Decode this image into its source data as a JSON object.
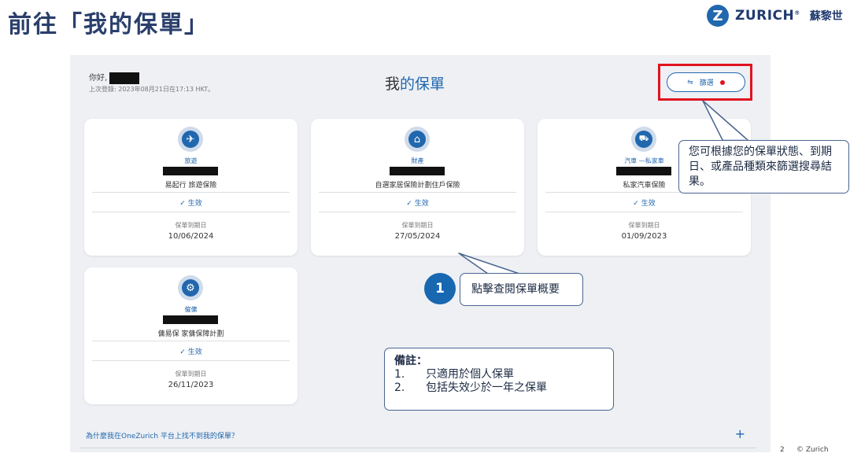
{
  "slide": {
    "title": "前往「我的保單」",
    "logo_mark": "Z",
    "logo_text": "ZURICH",
    "logo_reg": "®",
    "logo_cn": "蘇黎世",
    "page_number": "2",
    "footer_brand": "© Zurich"
  },
  "screen": {
    "greeting": "你好,",
    "last_login": "上次登錄: 2023年08月21日在17:13 HKT。",
    "title_part1": "我",
    "title_part2": "的保單",
    "filter_label": "篩選",
    "filter_icon": "filter-icon",
    "faq_link": "為什麼我在OneZurich 平台上找不到我的保單？",
    "faq_icon": "+"
  },
  "cards": [
    {
      "icon": "airplane-icon",
      "glyph": "✈",
      "category": "旅遊",
      "product": "易起行 旅遊保險",
      "status": "✓ 生效",
      "expiry_label": "保單到期日",
      "expiry_date": "10/06/2024"
    },
    {
      "icon": "house-icon",
      "glyph": "⌂",
      "category": "財產",
      "product": "自選家居保險計劃住戶保險",
      "status": "✓ 生效",
      "expiry_label": "保單到期日",
      "expiry_date": "27/05/2024"
    },
    {
      "icon": "car-icon",
      "glyph": "🚗",
      "category": "汽車 —私家車",
      "product": "私家汽車保險",
      "status": "✓ 生效",
      "expiry_label": "保單到期日",
      "expiry_date": "01/09/2023"
    },
    {
      "icon": "gear-icon",
      "glyph": "⚙",
      "category": "僱傭",
      "product": "傭易保 家傭保障計劃",
      "status": "✓ 生效",
      "expiry_label": "保單到期日",
      "expiry_date": "26/11/2023"
    }
  ],
  "callouts": {
    "filter_tip": "您可根據您的保單狀態、到期日、或產品種類來篩選搜尋結果。",
    "step_number": "1",
    "click_tip": "點擊查閱保單概要",
    "note_title": "備註：",
    "note_items": [
      {
        "num": "1.",
        "text": "只適用於個人保單"
      },
      {
        "num": "2.",
        "text": "包括失效少於一年之保單"
      }
    ]
  },
  "colors": {
    "accent": "#2167ae",
    "highlight": "#e0141e",
    "title": "#2a3f6b"
  }
}
